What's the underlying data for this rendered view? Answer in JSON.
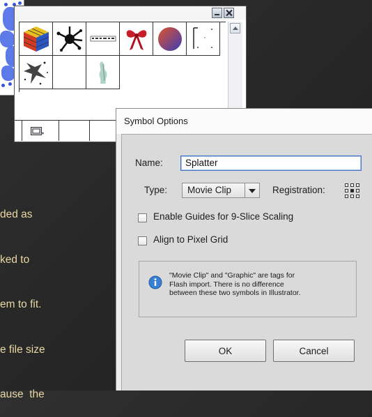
{
  "background_text": {
    "lines": [
      "ded as",
      "ked to",
      "em to fit.",
      "e file size",
      "ause  the"
    ]
  },
  "symbols_panel": {
    "symbols": [
      {
        "name": "rubiks-cube"
      },
      {
        "name": "ink-splat"
      },
      {
        "name": "text-banner"
      },
      {
        "name": "red-bow"
      },
      {
        "name": "gradient-sphere"
      },
      {
        "name": "dotted-frame"
      },
      {
        "name": "splatter"
      },
      {
        "name": "empty"
      },
      {
        "name": "grunge-figure"
      }
    ]
  },
  "symbol_options": {
    "title": "Symbol Options",
    "name_label": "Name:",
    "name_value": "Splatter",
    "type_label": "Type:",
    "type_value": "Movie Clip",
    "registration_label": "Registration:",
    "enable_guides_label": "Enable Guides for 9-Slice Scaling",
    "enable_guides_checked": false,
    "align_pixel_label": "Align to Pixel Grid",
    "align_pixel_checked": false,
    "info_lines": [
      "\"Movie Clip\" and \"Graphic\" are tags for",
      "Flash import. There is no difference",
      "between these two symbols in Illustrator."
    ],
    "ok_label": "OK",
    "cancel_label": "Cancel"
  },
  "colors": {
    "background_text": "#e9d7a4",
    "dialog_body": "#dadada",
    "input_focus": "#3f75c4",
    "artwork_blue": "#3a56d8"
  }
}
